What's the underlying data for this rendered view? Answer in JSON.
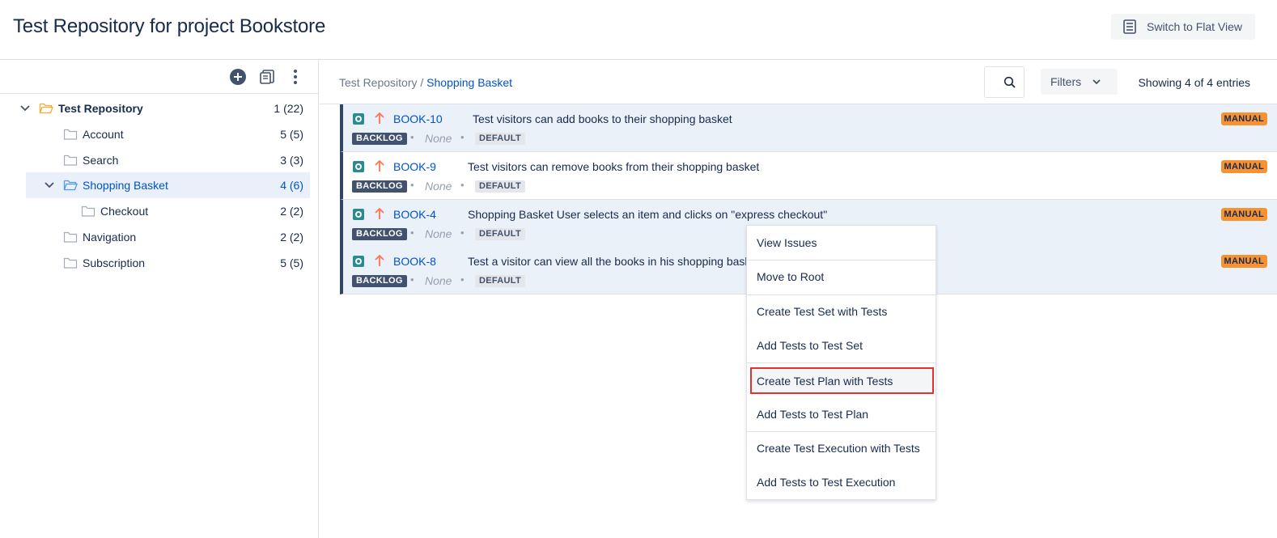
{
  "header": {
    "title": "Test Repository for project Bookstore",
    "flat_view_label": "Switch to Flat View",
    "flat_view_icon": "list-icon"
  },
  "left_toolbar": {
    "icons": [
      "add-circle-icon",
      "copy-icon",
      "more-vertical-icon"
    ]
  },
  "tree": [
    {
      "label": "Test Repository",
      "count": "1 (22)",
      "level": 0,
      "expanded": true,
      "open_folder": true
    },
    {
      "label": "Account",
      "count": "5 (5)",
      "level": 1
    },
    {
      "label": "Search",
      "count": "3 (3)",
      "level": 1
    },
    {
      "label": "Shopping Basket",
      "count": "4 (6)",
      "level": 1,
      "expanded": true,
      "selected": true,
      "open_folder": true
    },
    {
      "label": "Checkout",
      "count": "2 (2)",
      "level": 2
    },
    {
      "label": "Navigation",
      "count": "2 (2)",
      "level": 1
    },
    {
      "label": "Subscription",
      "count": "5 (5)",
      "level": 1
    }
  ],
  "breadcrumb": {
    "root": "Test Repository",
    "separator": " / ",
    "current": "Shopping Basket"
  },
  "toolbar": {
    "filters_label": "Filters",
    "entries_text": "Showing 4 of 4 entries"
  },
  "tests": [
    {
      "key": "BOOK-10",
      "summary": "Test visitors can add books to their shopping basket",
      "status": "BACKLOG",
      "assignee": "None",
      "lozenge": "DEFAULT",
      "type": "MANUAL"
    },
    {
      "key": "BOOK-9",
      "summary": "Test visitors can remove books from their shopping basket",
      "status": "BACKLOG",
      "assignee": "None",
      "lozenge": "DEFAULT",
      "type": "MANUAL"
    },
    {
      "key": "BOOK-4",
      "summary": "Shopping Basket User selects an item and clicks on \"express checkout\"",
      "status": "BACKLOG",
      "assignee": "None",
      "lozenge": "DEFAULT",
      "type": "MANUAL"
    },
    {
      "key": "BOOK-8",
      "summary": "Test a visitor can view all the books in his shopping basket",
      "status": "BACKLOG",
      "assignee": "None",
      "lozenge": "DEFAULT",
      "type": "MANUAL"
    }
  ],
  "context_menu": [
    "View Issues",
    "Move to Root",
    "Create Test Set with Tests",
    "Add Tests to Test Set",
    "Create Test Plan with Tests",
    "Add Tests to Test Plan",
    "Create Test Execution with Tests",
    "Add Tests to Test Execution"
  ],
  "colors": {
    "accent": "#0052cc",
    "manual_badge": "#f79232",
    "status_badge": "#42526e",
    "highlight_outline": "#e5322d"
  }
}
